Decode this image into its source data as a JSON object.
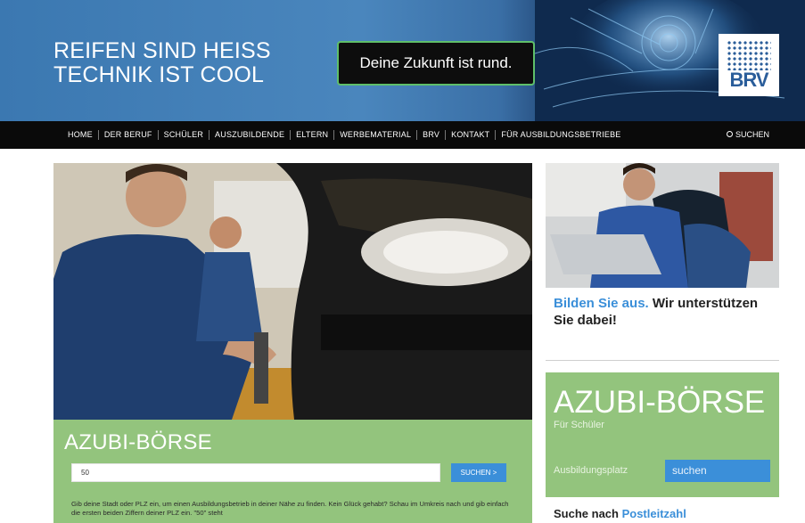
{
  "header": {
    "slogan_line1": "REIFEN SIND HEISS",
    "slogan_line2": "TECHNIK IST COOL",
    "tagline": "Deine Zukunft ist rund.",
    "logo_text": "BRV"
  },
  "nav": {
    "items": [
      {
        "label": "HOME"
      },
      {
        "label": "DER BERUF"
      },
      {
        "label": "SCHÜLER"
      },
      {
        "label": "AUSZUBILDENDE"
      },
      {
        "label": "ELTERN"
      },
      {
        "label": "WERBEMATERIAL"
      },
      {
        "label": "BRV"
      },
      {
        "label": "KONTAKT"
      },
      {
        "label": "FÜR AUSBILDUNGSBETRIEBE"
      }
    ],
    "search_label": "SUCHEN"
  },
  "boerse": {
    "title": "AZUBI-BÖRSE",
    "input_value": "50",
    "button_label": "SUCHEN >",
    "description": "Gib deine Stadt oder PLZ ein, um einen Ausbildungsbetrieb in deiner Nähe zu finden. Kein Glück gehabt? Schau im Umkreis nach und gib einfach die ersten beiden Ziffern deiner PLZ ein. \"50\" steht"
  },
  "sidebar": {
    "ausbilden_blue": "Bilden Sie aus.",
    "ausbilden_rest": " Wir unterstützen Sie dabei!",
    "box_title": "AZUBI-BÖRSE",
    "box_subtitle": "Für Schüler",
    "box_label": "Ausbildungsplatz",
    "box_input_placeholder": "suchen",
    "plz_prefix": "Suche nach ",
    "plz_blue": "Postleitzahl"
  },
  "colors": {
    "header_blue": "#3b78b1",
    "nav_bg": "#0a0a0a",
    "green": "#93c47d",
    "accent_blue": "#3b8fd9"
  }
}
